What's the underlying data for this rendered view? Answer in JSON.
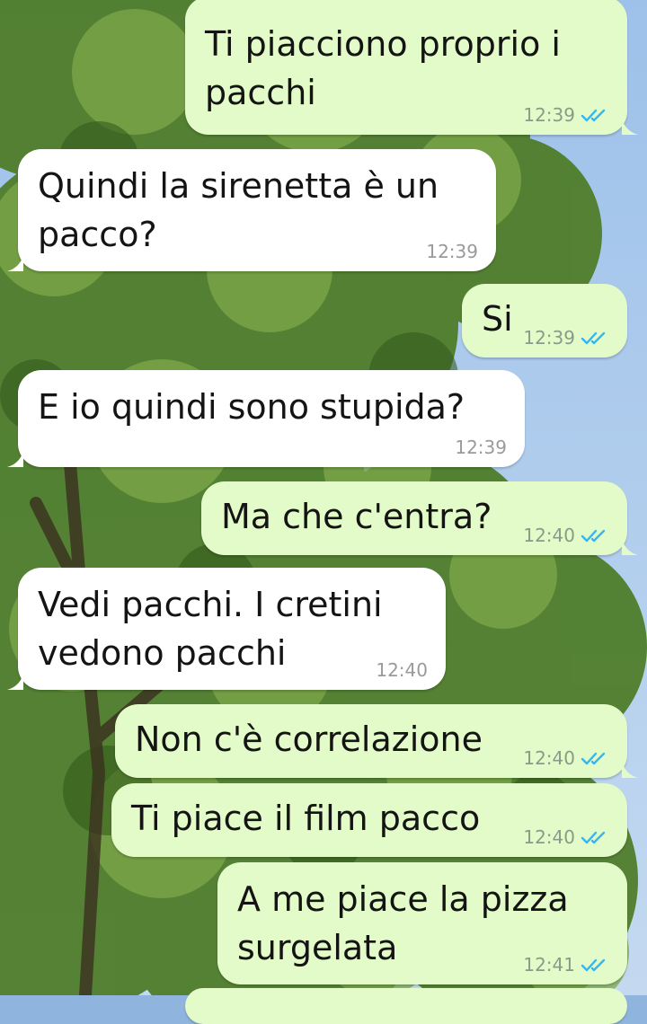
{
  "chat": {
    "messages": [
      {
        "id": "m1",
        "dir": "out",
        "text": "Ti piacciono proprio i\npacchi",
        "time": "12:39",
        "read": true
      },
      {
        "id": "m2",
        "dir": "in",
        "text": "Quindi la sirenetta è un\npacco?",
        "time": "12:39"
      },
      {
        "id": "m3",
        "dir": "out",
        "text": "Si",
        "time": "12:39",
        "read": true
      },
      {
        "id": "m4",
        "dir": "in",
        "text": "E io quindi sono stupida?",
        "time": "12:39"
      },
      {
        "id": "m5",
        "dir": "out",
        "text": "Ma che c'entra?",
        "time": "12:40",
        "read": true
      },
      {
        "id": "m6",
        "dir": "in",
        "text": "Vedi pacchi. I cretini\nvedono pacchi",
        "time": "12:40"
      },
      {
        "id": "m7",
        "dir": "out",
        "text": "Non c'è correlazione",
        "time": "12:40",
        "read": true
      },
      {
        "id": "m8",
        "dir": "out",
        "text": "Ti piace il film pacco",
        "time": "12:40",
        "read": true
      },
      {
        "id": "m9",
        "dir": "out",
        "text": "A me piace la pizza\nsurgelata",
        "time": "12:41",
        "read": true
      }
    ]
  },
  "colors": {
    "outgoing_bubble": "#e3fbc8",
    "incoming_bubble": "#ffffff",
    "read_ticks": "#34b7f1"
  },
  "icons": {
    "read_receipt": "double-check-icon",
    "wallpaper": "tree-photo-wallpaper"
  }
}
